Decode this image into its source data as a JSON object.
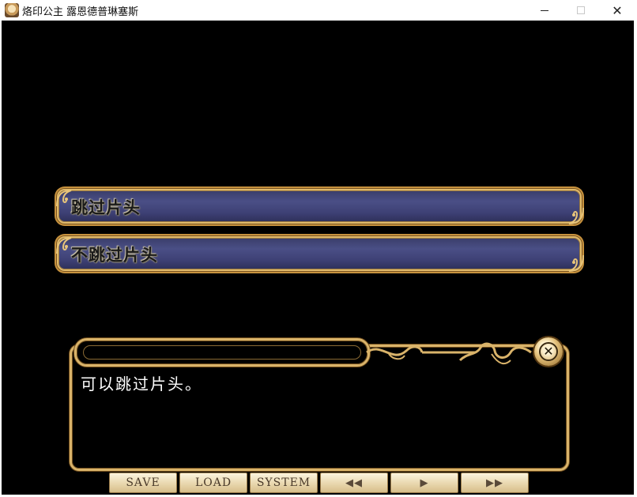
{
  "window": {
    "title": "烙印公主 露恩德普琳塞斯",
    "controls": {
      "minimize": "—",
      "maximize": "☐",
      "close": "✕"
    }
  },
  "choices": [
    {
      "label": "跳过片头"
    },
    {
      "label": "不跳过片头"
    }
  ],
  "message": {
    "speaker": "",
    "text": "可以跳过片头。",
    "close_glyph": "✕"
  },
  "toolbar": {
    "save": "SAVE",
    "load": "LOAD",
    "system": "SYSTEM",
    "rewind_glyph": "◀◀",
    "play_glyph": "▶",
    "forward_glyph": "▶▶"
  },
  "colors": {
    "choice_fill": "#4a4f86",
    "gold_frame": "#d9b36a",
    "background": "#000000"
  }
}
